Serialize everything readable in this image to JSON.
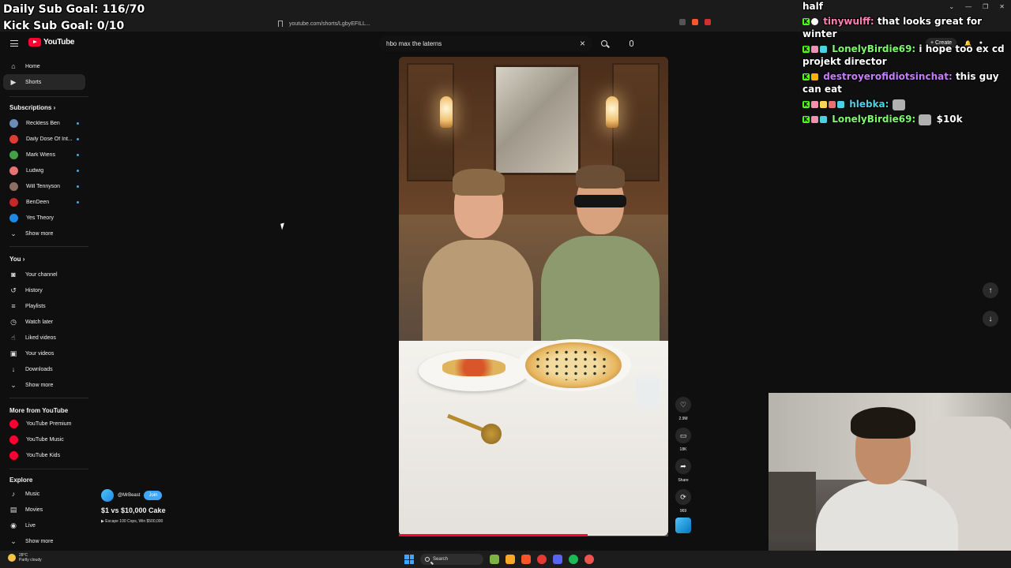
{
  "stream_overlay": {
    "daily_sub_goal": "Daily Sub Goal: 116/70",
    "kick_sub_goal": "Kick Sub Goal: 0/10"
  },
  "browser": {
    "url": "youtube.com/shorts/LgbyEFILL..."
  },
  "youtube": {
    "logo_text": "YouTube",
    "search_query": "hbo max the laterns",
    "create_label": "Create"
  },
  "sidebar": {
    "main": [
      {
        "label": "Home",
        "icon": "home-icon"
      },
      {
        "label": "Shorts",
        "icon": "shorts-icon"
      }
    ],
    "subscriptions_heading": "Subscriptions",
    "subscriptions": [
      {
        "label": "Reckless Ben",
        "color": "#6d8ab5"
      },
      {
        "label": "Daily Dose Of Int...",
        "color": "#e53935"
      },
      {
        "label": "Mark Wiens",
        "color": "#43a047"
      },
      {
        "label": "Ludwig",
        "color": "#e57373"
      },
      {
        "label": "Will Tennyson",
        "color": "#8d6e63"
      },
      {
        "label": "BenDeen",
        "color": "#c62828"
      },
      {
        "label": "Yes Theory",
        "color": "#1e88e5"
      }
    ],
    "subs_show_more": "Show more",
    "you_heading": "You",
    "you_items": [
      {
        "label": "Your channel",
        "icon": "channel-icon"
      },
      {
        "label": "History",
        "icon": "history-icon"
      },
      {
        "label": "Playlists",
        "icon": "playlists-icon"
      },
      {
        "label": "Watch later",
        "icon": "clock-icon"
      },
      {
        "label": "Liked videos",
        "icon": "thumbs-up-icon"
      },
      {
        "label": "Your videos",
        "icon": "video-icon"
      },
      {
        "label": "Downloads",
        "icon": "download-icon"
      }
    ],
    "you_show_more": "Show more",
    "more_heading": "More from YouTube",
    "more_items": [
      {
        "label": "YouTube Premium"
      },
      {
        "label": "YouTube Music"
      },
      {
        "label": "YouTube Kids"
      }
    ],
    "explore_heading": "Explore",
    "explore_items": [
      {
        "label": "Music",
        "icon": "music-icon"
      },
      {
        "label": "Movies",
        "icon": "movies-icon"
      },
      {
        "label": "Live",
        "icon": "live-icon"
      }
    ],
    "explore_show_more": "Show more"
  },
  "short": {
    "channel": "@MrBeast",
    "join_label": "Join",
    "title": "$1 vs $10,000 Cake",
    "linked_video": "Escape 100 Cops, Win $500,000",
    "likes": "2.9M",
    "comments": "18K",
    "share_label": "Share",
    "remix_count": "969",
    "progress": 0.7
  },
  "chat": {
    "lines": [
      {
        "user": "",
        "text": "half",
        "color": "#ffffff"
      },
      {
        "user": "tinywulff:",
        "text": "that looks great for winter",
        "color": "#ff7eb6"
      },
      {
        "user": "LonelyBirdie69:",
        "text": "i hope too ex cd projekt director",
        "color": "#7cfc6a"
      },
      {
        "user": "destroyerofidiotsinchat:",
        "text": "this guy can eat",
        "color": "#c77dff"
      },
      {
        "user": "hlebka:",
        "text": "",
        "color": "#4dd0e1"
      },
      {
        "user": "LonelyBirdie69:",
        "text": "$10k",
        "color": "#7cfc6a"
      }
    ]
  },
  "taskbar": {
    "temp": "28°C",
    "weather": "Partly cloudy",
    "search_label": "Search"
  }
}
